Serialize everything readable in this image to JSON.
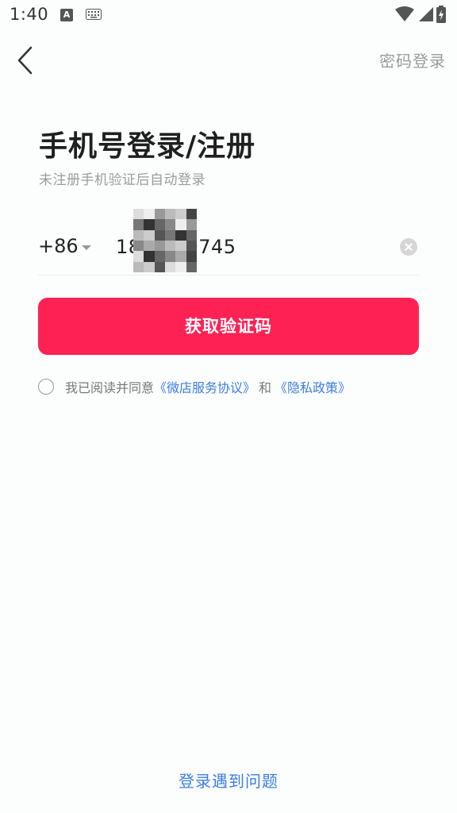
{
  "status_bar": {
    "time": "1:40",
    "notification_letter": "A"
  },
  "header": {
    "password_login": "密码登录"
  },
  "page": {
    "title": "手机号登录/注册",
    "subtitle": "未注册手机验证后自动登录"
  },
  "phone": {
    "country_code": "+86",
    "value": "18       0745"
  },
  "button": {
    "get_code": "获取验证码"
  },
  "agreement": {
    "prefix": "我已阅读并同意",
    "service_link": "《微店服务协议》",
    "connector": "和",
    "privacy_link": "《隐私政策》"
  },
  "footer": {
    "trouble_link": "登录遇到问题"
  },
  "colors": {
    "primary": "#fe2254",
    "link": "#3c7de0"
  }
}
